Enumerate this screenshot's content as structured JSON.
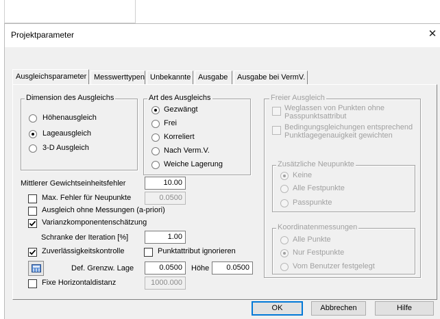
{
  "dialog": {
    "title": "Projektparameter",
    "close_label": "✕"
  },
  "tabs": [
    {
      "label": "Ausgleichsparameter"
    },
    {
      "label": "Messwerttypen"
    },
    {
      "label": "Unbekannte"
    },
    {
      "label": "Ausgabe"
    },
    {
      "label": "Ausgabe bei VermV."
    }
  ],
  "dimension": {
    "label": "Dimension des Ausgleichs",
    "options": [
      {
        "label": "Höhenausgleich",
        "checked": false
      },
      {
        "label": "Lageausgleich",
        "checked": true
      },
      {
        "label": "3-D Ausgleich",
        "checked": false
      }
    ]
  },
  "art": {
    "label": "Art des Ausgleichs",
    "options": [
      {
        "label": "Gezwängt",
        "checked": true
      },
      {
        "label": "Frei",
        "checked": false
      },
      {
        "label": "Korreliert",
        "checked": false
      },
      {
        "label": "Nach Verm.V.",
        "checked": false
      },
      {
        "label": "Weiche Lagerung",
        "checked": false
      }
    ]
  },
  "freier": {
    "label": "Freier Ausgleich",
    "options": [
      {
        "line1": "Weglassen von Punkten ohne",
        "line2": "Passpunktsattribut"
      },
      {
        "line1": "Bedingungsgleichungen entsprechend",
        "line2": "Punktlagegenauigkeit gewichten"
      }
    ]
  },
  "zusaetzliche": {
    "label": "Zusätzliche Neupunkte",
    "options": [
      {
        "label": "Keine",
        "checked": true
      },
      {
        "label": "Alle Festpunkte",
        "checked": false
      },
      {
        "label": "Passpunkte",
        "checked": false
      }
    ]
  },
  "koordinaten": {
    "label": "Koordinatenmessungen",
    "options": [
      {
        "label": "Alle Punkte",
        "checked": false
      },
      {
        "label": "Nur Festpunkte",
        "checked": true
      },
      {
        "label": "Vom Benutzer festgelegt",
        "checked": false
      }
    ]
  },
  "fields": {
    "gewicht_label": "Mittlerer Gewichtseinheitsfehler",
    "gewicht_value": "10.00",
    "maxfehler_label": "Max. Fehler für Neupunkte",
    "maxfehler_value": "0.0500",
    "ohne_messungen_label": "Ausgleich ohne Messungen (a-priori)",
    "varianz_label": "Varianzkomponentenschätzung",
    "schranke_label": "Schranke der Iteration [%]",
    "schranke_value": "1.00",
    "zuverl_label": "Zuverlässigkeitskontrolle",
    "punktattribut_label": "Punktattribut ignorieren",
    "grenzw_label": "Def. Grenzw. Lage",
    "grenzw_lage_value": "0.0500",
    "hoehe_label": "Höhe",
    "grenzw_hoehe_value": "0.0500",
    "fixe_label": "Fixe Horizontaldistanz",
    "fixe_value": "1000.000"
  },
  "checks": {
    "maxfehler": false,
    "ohne_messungen": false,
    "varianz": true,
    "zuverl": true,
    "punktattribut": false,
    "fixe": false
  },
  "buttons": {
    "ok": "OK",
    "abbrechen": "Abbrechen",
    "hilfe": "Hilfe"
  },
  "icons": {
    "calc": "calculator-icon",
    "check": "checkmark-icon",
    "close": "close-icon"
  }
}
